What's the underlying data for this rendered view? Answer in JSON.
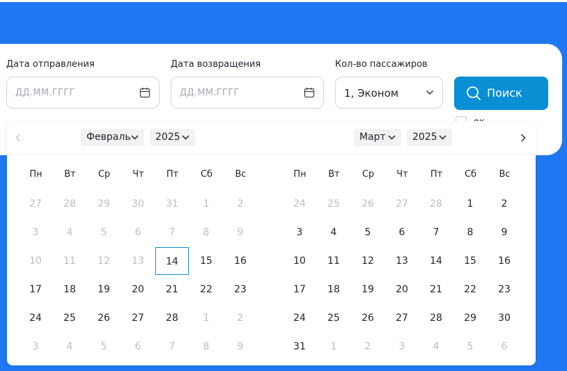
{
  "form": {
    "departure_label": "Дата отправления",
    "departure_placeholder": "ДД.ММ.ГГГГ",
    "return_label": "Дата возвращения",
    "return_placeholder": "ДД.ММ.ГГГГ",
    "passengers_label": "Кол-во пассажиров",
    "passengers_value": "1, Эконом",
    "search_label": "Поиск",
    "checkbox_label": "ок"
  },
  "calendar": {
    "left": {
      "month": "Февраль",
      "year": "2025",
      "weekdays": [
        "Пн",
        "Вт",
        "Ср",
        "Чт",
        "Пт",
        "Сб",
        "Вс"
      ],
      "weeks": [
        [
          {
            "d": "27",
            "m": true
          },
          {
            "d": "28",
            "m": true
          },
          {
            "d": "29",
            "m": true
          },
          {
            "d": "30",
            "m": true
          },
          {
            "d": "31",
            "m": true
          },
          {
            "d": "1",
            "m": true
          },
          {
            "d": "2",
            "m": true
          }
        ],
        [
          {
            "d": "3",
            "m": true
          },
          {
            "d": "4",
            "m": true
          },
          {
            "d": "5",
            "m": true
          },
          {
            "d": "6",
            "m": true
          },
          {
            "d": "7",
            "m": true
          },
          {
            "d": "8",
            "m": true
          },
          {
            "d": "9",
            "m": true
          }
        ],
        [
          {
            "d": "10",
            "m": true
          },
          {
            "d": "11",
            "m": true
          },
          {
            "d": "12",
            "m": true
          },
          {
            "d": "13",
            "m": true
          },
          {
            "d": "14",
            "m": false,
            "sel": true
          },
          {
            "d": "15",
            "m": false
          },
          {
            "d": "16",
            "m": false
          }
        ],
        [
          {
            "d": "17",
            "m": false
          },
          {
            "d": "18",
            "m": false
          },
          {
            "d": "19",
            "m": false
          },
          {
            "d": "20",
            "m": false
          },
          {
            "d": "21",
            "m": false
          },
          {
            "d": "22",
            "m": false
          },
          {
            "d": "23",
            "m": false
          }
        ],
        [
          {
            "d": "24",
            "m": false
          },
          {
            "d": "25",
            "m": false
          },
          {
            "d": "26",
            "m": false
          },
          {
            "d": "27",
            "m": false
          },
          {
            "d": "28",
            "m": false
          },
          {
            "d": "1",
            "m": true
          },
          {
            "d": "2",
            "m": true
          }
        ],
        [
          {
            "d": "3",
            "m": true
          },
          {
            "d": "4",
            "m": true
          },
          {
            "d": "5",
            "m": true
          },
          {
            "d": "6",
            "m": true
          },
          {
            "d": "7",
            "m": true
          },
          {
            "d": "8",
            "m": true
          },
          {
            "d": "9",
            "m": true
          }
        ]
      ]
    },
    "right": {
      "month": "Март",
      "year": "2025",
      "weekdays": [
        "Пн",
        "Вт",
        "Ср",
        "Чт",
        "Пт",
        "Сб",
        "Вс"
      ],
      "weeks": [
        [
          {
            "d": "24",
            "m": true
          },
          {
            "d": "25",
            "m": true
          },
          {
            "d": "26",
            "m": true
          },
          {
            "d": "27",
            "m": true
          },
          {
            "d": "28",
            "m": true
          },
          {
            "d": "1",
            "m": false
          },
          {
            "d": "2",
            "m": false
          }
        ],
        [
          {
            "d": "3",
            "m": false
          },
          {
            "d": "4",
            "m": false
          },
          {
            "d": "5",
            "m": false
          },
          {
            "d": "6",
            "m": false
          },
          {
            "d": "7",
            "m": false
          },
          {
            "d": "8",
            "m": false
          },
          {
            "d": "9",
            "m": false
          }
        ],
        [
          {
            "d": "10",
            "m": false
          },
          {
            "d": "11",
            "m": false
          },
          {
            "d": "12",
            "m": false
          },
          {
            "d": "13",
            "m": false
          },
          {
            "d": "14",
            "m": false
          },
          {
            "d": "15",
            "m": false
          },
          {
            "d": "16",
            "m": false
          }
        ],
        [
          {
            "d": "17",
            "m": false
          },
          {
            "d": "18",
            "m": false
          },
          {
            "d": "19",
            "m": false
          },
          {
            "d": "20",
            "m": false
          },
          {
            "d": "21",
            "m": false
          },
          {
            "d": "22",
            "m": false
          },
          {
            "d": "23",
            "m": false
          }
        ],
        [
          {
            "d": "24",
            "m": false
          },
          {
            "d": "25",
            "m": false
          },
          {
            "d": "26",
            "m": false
          },
          {
            "d": "27",
            "m": false
          },
          {
            "d": "28",
            "m": false
          },
          {
            "d": "29",
            "m": false
          },
          {
            "d": "30",
            "m": false
          }
        ],
        [
          {
            "d": "31",
            "m": false
          },
          {
            "d": "1",
            "m": true
          },
          {
            "d": "2",
            "m": true
          },
          {
            "d": "3",
            "m": true
          },
          {
            "d": "4",
            "m": true
          },
          {
            "d": "5",
            "m": true
          },
          {
            "d": "6",
            "m": true
          }
        ]
      ]
    }
  },
  "colors": {
    "background_blue": "#1f78f2",
    "accent": "#0a8fd4",
    "muted_text": "#b9bec5"
  }
}
